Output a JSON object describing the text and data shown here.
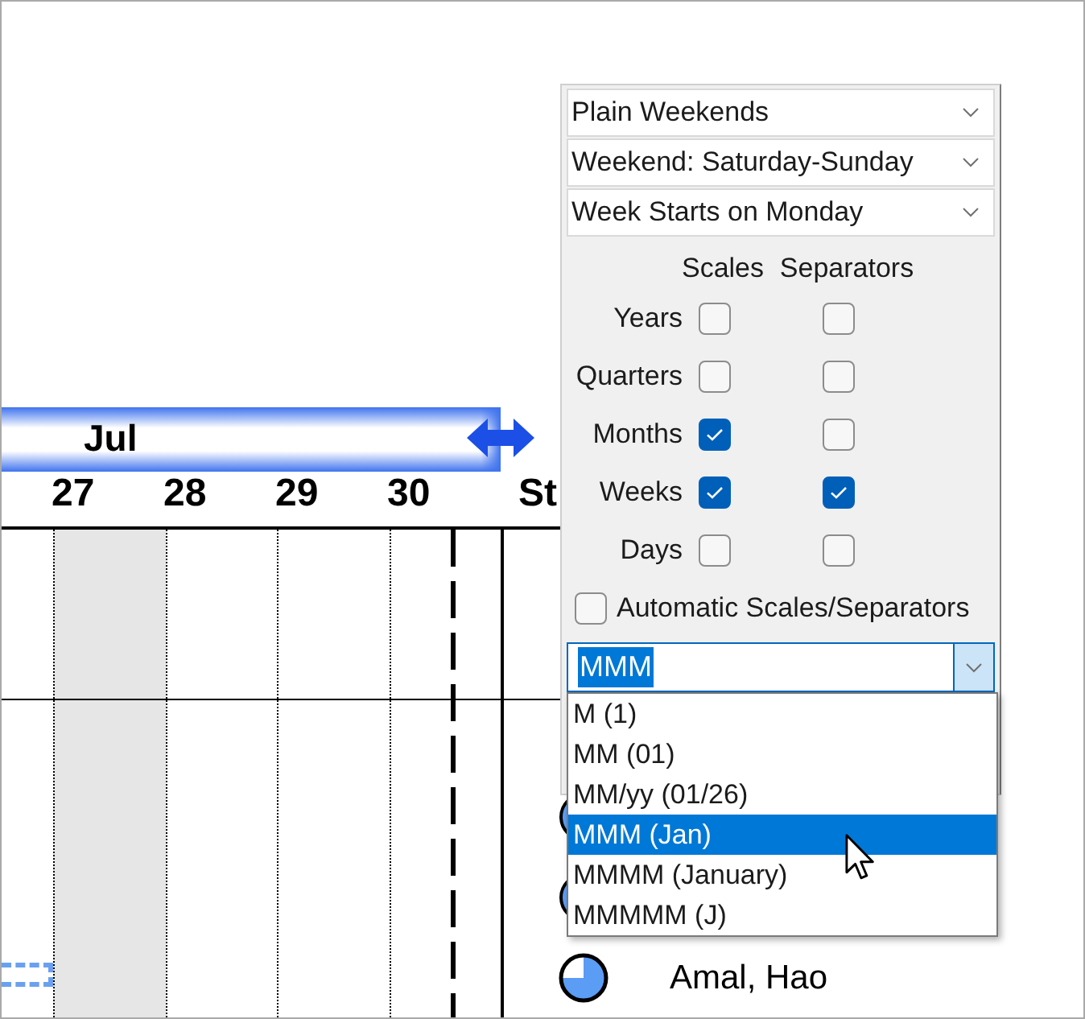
{
  "timeline": {
    "month_label": "Jul",
    "days": [
      {
        "label": "27",
        "shaded": true
      },
      {
        "label": "28",
        "shaded": false
      },
      {
        "label": "29",
        "shaded": false
      },
      {
        "label": "30",
        "shaded": false
      },
      {
        "label": "St",
        "shaded": false
      }
    ]
  },
  "resources": [
    {
      "name": "Amal, Hao"
    }
  ],
  "panel": {
    "dropdowns": [
      {
        "value": "Plain Weekends"
      },
      {
        "value": "Weekend: Saturday-Sunday"
      },
      {
        "value": "Week Starts on Monday"
      }
    ],
    "column_headers": [
      "Scales",
      "Separators"
    ],
    "rows": [
      {
        "label": "Years",
        "scales": false,
        "separators": false
      },
      {
        "label": "Quarters",
        "scales": false,
        "separators": false
      },
      {
        "label": "Months",
        "scales": true,
        "separators": false
      },
      {
        "label": "Weeks",
        "scales": true,
        "separators": true
      },
      {
        "label": "Days",
        "scales": false,
        "separators": false
      }
    ],
    "automatic": {
      "label": "Automatic Scales/Separators",
      "checked": false
    },
    "format_combo": {
      "value": "MMM",
      "text_selected": true,
      "expanded": true
    },
    "format_options": [
      {
        "label": "M (1)",
        "selected": false
      },
      {
        "label": "MM (01)",
        "selected": false
      },
      {
        "label": "MM/yy (01/26)",
        "selected": false
      },
      {
        "label": "MMM (Jan)",
        "selected": true
      },
      {
        "label": "MMMM (January)",
        "selected": false
      },
      {
        "label": "MMMMM (J)",
        "selected": false
      }
    ]
  }
}
